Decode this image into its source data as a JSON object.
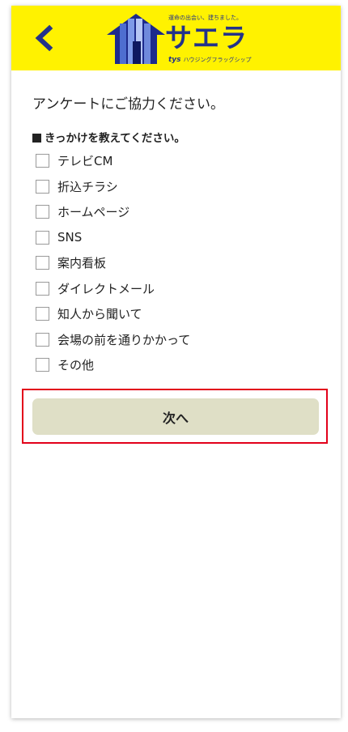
{
  "header": {
    "back_icon": "chevron-left-icon",
    "logo": {
      "tagline": "運命の出会い、建ちました。",
      "name": "サエラ",
      "brand_mark": "tys",
      "brand_text": "ハウジングフラッグシップ"
    },
    "colors": {
      "bar": "#fff200",
      "accent": "#23328a"
    }
  },
  "survey": {
    "title": "アンケートにご協力ください。",
    "question": "きっかけを教えてください。",
    "options": [
      {
        "label": "テレビCM",
        "checked": false
      },
      {
        "label": "折込チラシ",
        "checked": false
      },
      {
        "label": "ホームページ",
        "checked": false
      },
      {
        "label": "SNS",
        "checked": false
      },
      {
        "label": "案内看板",
        "checked": false
      },
      {
        "label": "ダイレクトメール",
        "checked": false
      },
      {
        "label": "知人から聞いて",
        "checked": false
      },
      {
        "label": "会場の前を通りかかって",
        "checked": false
      },
      {
        "label": "その他",
        "checked": false
      }
    ],
    "next_label": "次へ",
    "highlight_color": "#e2001a"
  }
}
